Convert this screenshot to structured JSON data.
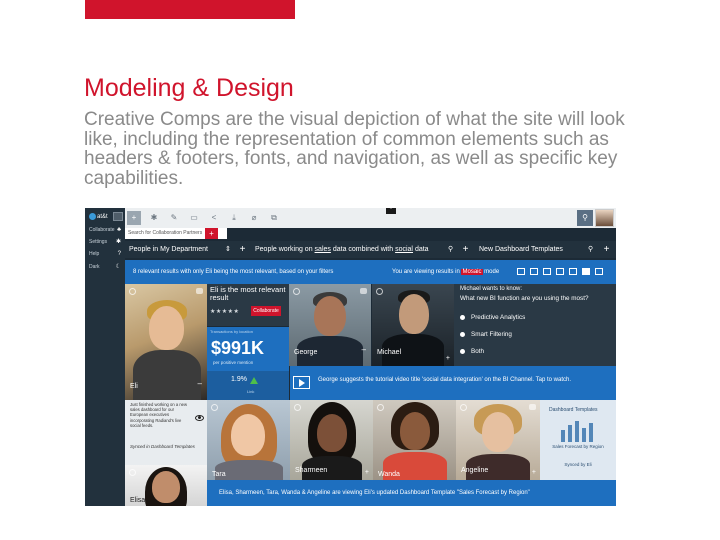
{
  "slide": {
    "title": "Modeling & Design",
    "body": "Creative Comps are the visual depiction of what the site will look like, including the representation of common elements such as headers & footers, fonts, and navigation, as well as specific key capabilities."
  },
  "app": {
    "logo": "at&t",
    "rail": [
      {
        "label": "Collaborate",
        "icon": "people-icon"
      },
      {
        "label": "Settings",
        "icon": "gear-icon"
      },
      {
        "label": "Help",
        "icon": "help-icon"
      },
      {
        "label": "Dark",
        "icon": "moon-icon"
      }
    ],
    "toolbar_icons": [
      "plus-icon",
      "settings-icon",
      "pencil-icon",
      "chat-icon",
      "share-icon",
      "download-icon",
      "attach-icon",
      "copy-icon"
    ],
    "collab_search_placeholder": "Search for Collaboration Partners",
    "filters": {
      "department": "People in My Department",
      "query_prefix": "People working on ",
      "query_term1": "sales",
      "query_mid": " data combined with ",
      "query_term2": "social",
      "query_suffix": " data",
      "templates": "New Dashboard Templates"
    },
    "results": {
      "summary": "8 relevant results with only Eli being the most relevant, based on your filters",
      "viewing_prefix": "You are viewing results in ",
      "mode": "Mosaic",
      "viewing_suffix": " mode"
    },
    "eli": {
      "name": "Eli",
      "headline": "Eli is the most relevant result",
      "stars": "★★★★★",
      "collaborate": "Collaborate",
      "transactions_label": "Transactions by location",
      "amount": "$991K",
      "amount_sub": "per positive mention",
      "pct": "1.9%",
      "link": "Link",
      "update": "Just finished working on a new sales dashboard for our European executives incorporating Radiand's live social feeds.",
      "synced": "Synced in Dashboard Templates"
    },
    "people": {
      "george": "George",
      "michael": "Michael",
      "elisa": "Elisa",
      "tara": "Tara",
      "sharmeen": "Sharmeen",
      "wanda": "Wanda",
      "angeline": "Angeline"
    },
    "question": {
      "from": "Michael wants to know:",
      "text": "What new BI function are you using the most?",
      "options": [
        "Predictive Analytics",
        "Smart Filtering",
        "Both"
      ]
    },
    "suggestion": "George suggests the tutorial video title 'social data integration' on the BI Channel. Tap to watch.",
    "dashboard_tile": {
      "title": "Dashboard Templates",
      "caption": "Sales Forecast by Region",
      "synced": "Synced by Eli",
      "bar_values": [
        0.55,
        0.75,
        0.95,
        0.65,
        0.85
      ]
    },
    "footer": "Elisa, Sharmeen, Tara, Wanda & Angeline are viewing Eli's updated Dashboard Template \"Sales Forecast by Region\"",
    "colors": {
      "accent": "#d0142c",
      "blue": "#1e6fbf",
      "dark": "#1c2a36"
    }
  }
}
